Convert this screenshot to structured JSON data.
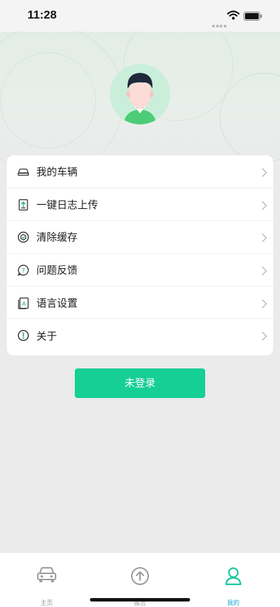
{
  "status_bar": {
    "time": "11:28"
  },
  "menu": {
    "items": [
      {
        "label": "我的车辆",
        "icon": "car-icon"
      },
      {
        "label": "一键日志上传",
        "icon": "upload-log-icon"
      },
      {
        "label": "清除缓存",
        "icon": "clear-cache-icon"
      },
      {
        "label": "问题反馈",
        "icon": "feedback-icon"
      },
      {
        "label": "语言设置",
        "icon": "language-icon"
      },
      {
        "label": "关于",
        "icon": "about-icon"
      }
    ]
  },
  "login_button": {
    "label": "未登录"
  },
  "tabs": [
    {
      "label": "主页",
      "icon": "car-icon",
      "active": false
    },
    {
      "label": "报告",
      "icon": "upload-circle-icon",
      "active": false
    },
    {
      "label": "我的",
      "icon": "person-icon",
      "active": true
    }
  ],
  "colors": {
    "accent": "#16cf95",
    "active_tab": "#1aa8d6",
    "menu_icon_stroke": "#2c2c2c",
    "menu_icon_green": "#1fb07a"
  }
}
